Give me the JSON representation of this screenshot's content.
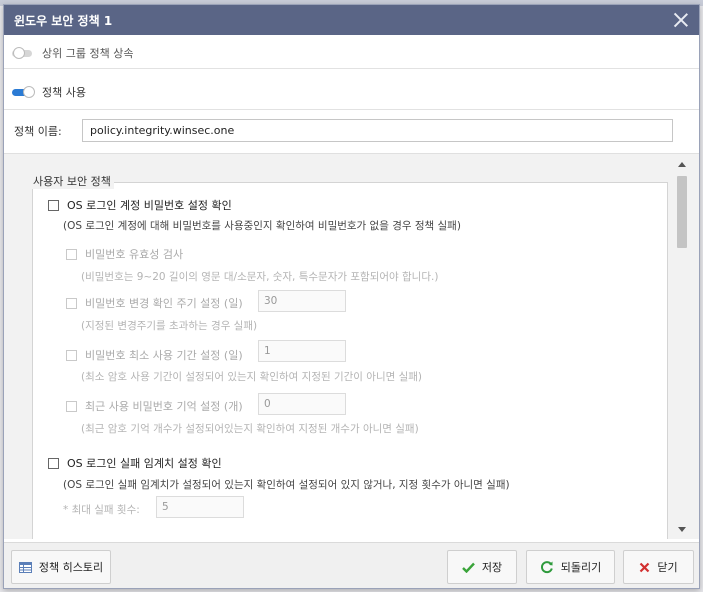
{
  "dialog": {
    "title": "윈도우 보안 정책 1",
    "inherit_label": "상위 그룹 정책 상속",
    "enable_label": "정책 사용",
    "name_label": "정책 이름:",
    "name_value": "policy.integrity.winsec.one"
  },
  "section": {
    "legend": "사용자 보안 정책",
    "items": [
      {
        "label": "OS 로그인 계정 비밀번호 설정 확인",
        "desc": "(OS 로그인 계정에 대해 비밀번호를 사용중인지 확인하여 비밀번호가 없을 경우 정책 실패)",
        "subs": [
          {
            "label": "비밀번호 유효성 검사",
            "desc": "(비밀번호는 9~20 길이의 영문 대/소문자, 숫자, 특수문자가 포함되어야 합니다.)"
          },
          {
            "label": "비밀번호 변경 확인 주기 설정 (일)",
            "value": "30",
            "desc": "(지정된 변경주기를 초과하는 경우 실패)"
          },
          {
            "label": "비밀번호 최소 사용 기간 설정 (일)",
            "value": "1",
            "desc": "(최소 암호 사용 기간이 설정되어 있는지 확인하여 지정된 기간이 아니면 실패)"
          },
          {
            "label": "최근 사용 비밀번호 기억 설정 (개)",
            "value": "0",
            "desc": "(최근 암호 기억 개수가 설정되어있는지 확인하여 지정된 개수가 아니면 실패)"
          }
        ]
      },
      {
        "label": "OS 로그인 실패 임계치 설정 확인",
        "desc": "(OS 로그인 실패 임계치가 설정되어 있는지 확인하여 설정되어 있지 않거나, 지정 횟수가 아니면 실패)",
        "max_fail_label": "* 최대 실패 횟수:",
        "max_fail_value": "5"
      }
    ]
  },
  "footer": {
    "history": "정책 히스토리",
    "save": "저장",
    "revert": "되돌리기",
    "close": "닫기"
  },
  "colors": {
    "titlebar": "#5a6586",
    "toggle_on": "#2b7bd4",
    "save_check": "#3aa43a",
    "revert_icon": "#2e9a3c",
    "close_x": "#d23030"
  }
}
